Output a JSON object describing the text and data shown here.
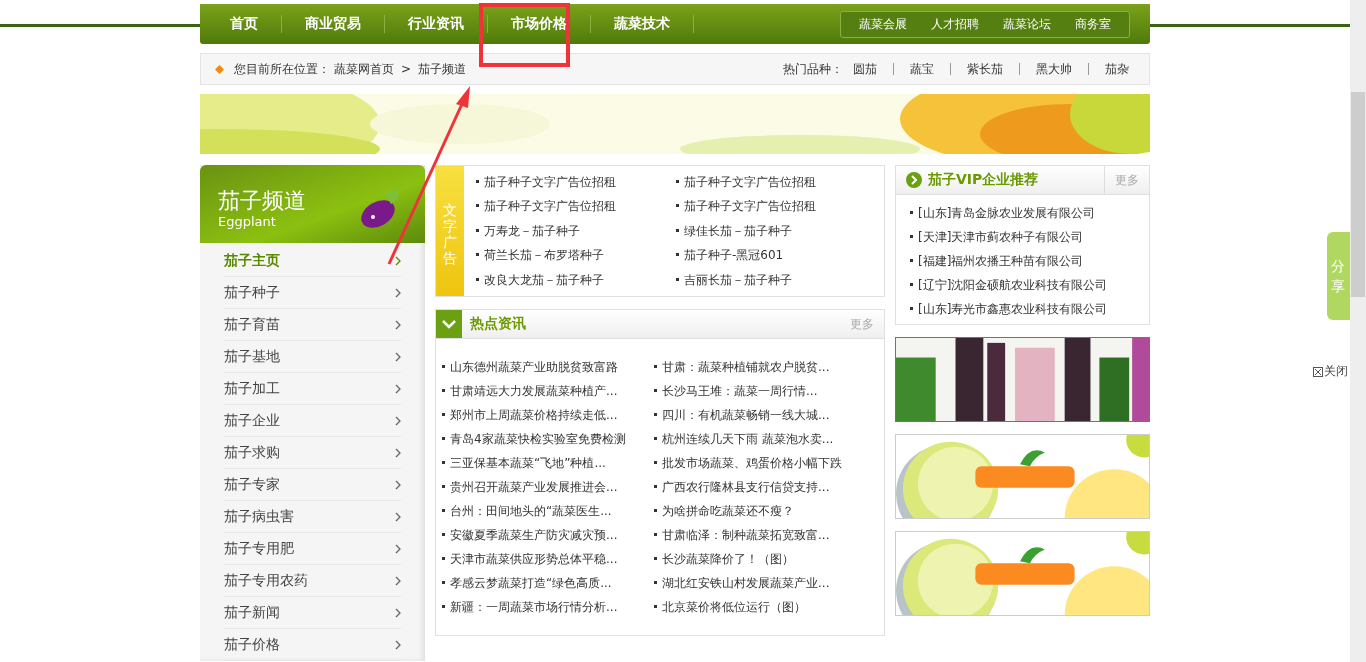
{
  "nav": {
    "items": [
      "首页",
      "商业贸易",
      "行业资讯",
      "市场价格",
      "蔬菜技术"
    ],
    "sub_links": [
      "蔬菜会展",
      "人才招聘",
      "蔬菜论坛",
      "商务室"
    ]
  },
  "breadcrumb": {
    "prefix": "您目前所在位置：",
    "links": [
      "蔬菜网首页",
      "茄子频道"
    ],
    "separator": ">"
  },
  "hot_varieties": {
    "label": "热门品种：",
    "items": [
      "圆茄",
      "蔬宝",
      "紫长茄",
      "黑大帅",
      "茄杂"
    ]
  },
  "sidebar": {
    "title": "茄子频道",
    "subtitle": "Eggplant",
    "items": [
      {
        "label": "茄子主页",
        "selected": true
      },
      {
        "label": "茄子种子",
        "selected": false
      },
      {
        "label": "茄子育苗",
        "selected": false
      },
      {
        "label": "茄子基地",
        "selected": false
      },
      {
        "label": "茄子加工",
        "selected": false
      },
      {
        "label": "茄子企业",
        "selected": false
      },
      {
        "label": "茄子求购",
        "selected": false
      },
      {
        "label": "茄子专家",
        "selected": false
      },
      {
        "label": "茄子病虫害",
        "selected": false
      },
      {
        "label": "茄子专用肥",
        "selected": false
      },
      {
        "label": "茄子专用农药",
        "selected": false
      },
      {
        "label": "茄子新闻",
        "selected": false
      },
      {
        "label": "茄子价格",
        "selected": false
      }
    ]
  },
  "text_ads": {
    "label": "文字广告",
    "items": [
      "茄子种子文字广告位招租",
      "茄子种子文字广告位招租",
      "茄子种子文字广告位招租",
      "茄子种子文字广告位招租",
      "万寿龙－茄子种子",
      "绿佳长茄－茄子种子",
      "荷兰长茄－布罗塔种子",
      "茄子种子-黑冠601",
      "改良大龙茄－茄子种子",
      "吉丽长茄－茄子种子"
    ]
  },
  "hot_news": {
    "title": "热点资讯",
    "more": "更多",
    "items": [
      "山东德州蔬菜产业助脱贫致富路",
      "甘肃：蔬菜种植铺就农户脱贫...",
      "甘肃靖远大力发展蔬菜种植产...",
      "长沙马王堆：蔬菜一周行情...",
      "郑州市上周蔬菜价格持续走低...",
      "四川：有机蔬菜畅销一线大城...",
      "青岛4家蔬菜快检实验室免费检测",
      "杭州连续几天下雨 蔬菜泡水卖...",
      "三亚保基本蔬菜“飞地”种植...",
      "批发市场蔬菜、鸡蛋价格小幅下跌",
      "贵州召开蔬菜产业发展推进会...",
      "广西农行隆林县支行信贷支持...",
      "台州：田间地头的“蔬菜医生...",
      "为啥拼命吃蔬菜还不瘦？",
      "安徽夏季蔬菜生产防灾减灾预...",
      "甘肃临泽：制种蔬菜拓宽致富...",
      "天津市蔬菜供应形势总体平稳...",
      "长沙蔬菜降价了！（图）",
      "孝感云梦蔬菜打造“绿色高质...",
      "湖北红安铁山村发展蔬菜产业...",
      "新疆：一周蔬菜市场行情分析...",
      "北京菜价将低位运行（图）"
    ]
  },
  "vip": {
    "title": "茄子VIP企业推荐",
    "more": "更多",
    "items": [
      "[山东]青岛金脉农业发展有限公司",
      "[天津]天津市蓟农种子有限公司",
      "[福建]福州农播王种苗有限公司",
      "[辽宁]沈阳金硕航农业科技有限公司",
      "[山东]寿光市鑫惠农业科技有限公司"
    ]
  },
  "share": {
    "label": "分享",
    "close": "关闭"
  }
}
